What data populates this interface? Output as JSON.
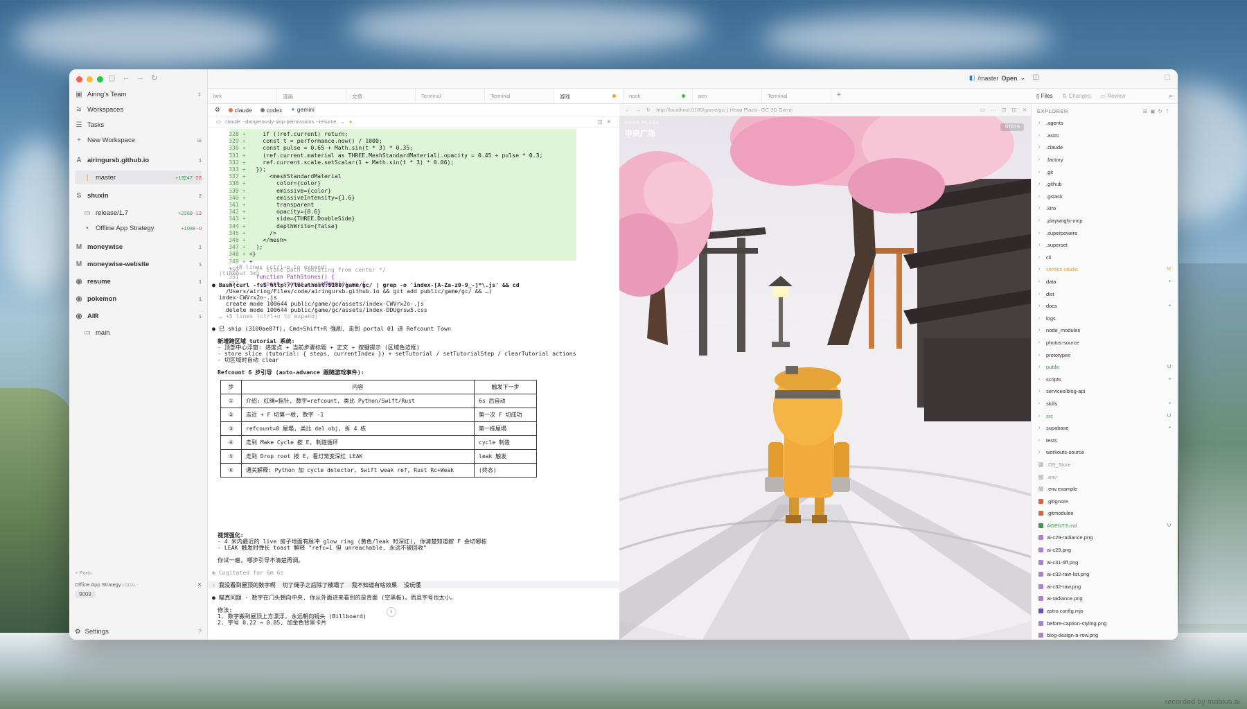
{
  "sidebar": {
    "team": "Airing's Team",
    "workspaces_label": "Workspaces",
    "tasks_label": "Tasks",
    "new_workspace_label": "New Workspace",
    "repos": [
      {
        "name": "airingursb.github.io",
        "count": "1",
        "sub": [
          {
            "name": "master",
            "added": "+13247",
            "removed": "-28"
          }
        ]
      },
      {
        "name": "shuxin",
        "count": "2",
        "sub": [
          {
            "name": "release/1.7",
            "added": "+2268",
            "removed": "-13"
          },
          {
            "name": "Offline App Strategy",
            "added": "+1088",
            "removed": "-0"
          }
        ]
      },
      {
        "name": "moneywise",
        "count": "1"
      },
      {
        "name": "moneywise-website",
        "count": "1"
      },
      {
        "name": "resume",
        "count": "1"
      },
      {
        "name": "pokemon",
        "count": "1"
      },
      {
        "name": "AIR",
        "count": "1",
        "sub": [
          {
            "name": "main"
          }
        ]
      }
    ],
    "ports_label": "Ports",
    "port_item": "Offline App Strategy",
    "port_local": "LOCAL",
    "port_number": "9009",
    "settings_label": "Settings"
  },
  "topbar": {
    "branch": "/master",
    "open_label": "Open"
  },
  "tabs": [
    {
      "label": "lark"
    },
    {
      "label": "漫画"
    },
    {
      "label": "文章"
    },
    {
      "label": "Terminal"
    },
    {
      "label": "Terminal"
    },
    {
      "label": "游戏",
      "active": true,
      "status_color": "#f0a030"
    },
    {
      "label": "nook",
      "status_color": "#3ab84a"
    },
    {
      "label": "pen"
    },
    {
      "label": "Terminal"
    }
  ],
  "agents": [
    {
      "label": "claude",
      "color": "#e07050"
    },
    {
      "label": "codex",
      "color": "#777777"
    },
    {
      "label": "gemini",
      "color": "#5a7ae0"
    }
  ],
  "cmdline": "claude --dangerously-skip-permissions --resume",
  "terminal": {
    "diff_lines": [
      {
        "n": "328",
        "code": "    if (!ref.current) return;"
      },
      {
        "n": "329",
        "code": "    const t = performance.now() / 1000;"
      },
      {
        "n": "330",
        "code": "    const pulse = 0.65 + Math.sin(t * 3) * 0.35;"
      },
      {
        "n": "331",
        "code": "    (ref.current.material as THREE.MeshStandardMaterial).opacity = 0.45 + pulse * 0.3;"
      },
      {
        "n": "332",
        "code": "    ref.current.scale.setScalar(1 + Math.sin(t * 3) * 0.06);"
      },
      {
        "n": "333",
        "code": "  });"
      },
      {
        "n": "337",
        "code": "      <meshStandardMaterial"
      },
      {
        "n": "338",
        "code": "        color={color}"
      },
      {
        "n": "339",
        "code": "        emissive={color}"
      },
      {
        "n": "340",
        "code": "        emissiveIntensity={1.6}"
      },
      {
        "n": "341",
        "code": "        transparent"
      },
      {
        "n": "342",
        "code": "        opacity={0.6}"
      },
      {
        "n": "343",
        "code": "        side={THREE.DoubleSide}"
      },
      {
        "n": "344",
        "code": "        depthWrite={false}"
      },
      {
        "n": "345",
        "code": "      />"
      },
      {
        "n": "346",
        "code": "    </mesh>"
      },
      {
        "n": "347",
        "code": "  );"
      },
      {
        "n": "348",
        "code": "+}"
      },
      {
        "n": "349",
        "code": "+"
      }
    ],
    "ctx_lines": [
      {
        "n": "350",
        "code": "  /* Stone path radiating from center */"
      },
      {
        "n": "351",
        "code": "  function PathStones() {"
      },
      {
        "n": "352",
        "code": "    const stones = useMemo(() => {"
      }
    ],
    "expand1": "… +8 lines (ctrl+o to expand)",
    "timeout": "(timeout 3m)",
    "bash1": "Bash(curl -fsS http://localhost:5180/game/gc/ | grep -o 'index-[A-Za-z0-9_-]*\\.js' && cd",
    "bash2": "  /Users/airing/Files/code/airingursb.github.io && git add public/game/gc/ && …)",
    "bash3": "index-CWVrx2o-.js",
    "bash4": "  create mode 100644 public/game/gc/assets/index-CWVrx2o-.js",
    "bash5": "  delete mode 100644 public/game/gc/assets/index-DDUgrsw5.css",
    "expand2": "… +5 lines (ctrl+o to expand)",
    "ship": "已 ship (3100ae07f), Cmd+Shift+R 强刷, 走到 portal 01 进 Refcount Town",
    "new_sys_title": "新增跨区域 tutorial 系统:",
    "new_sys_1": "- 顶部中心浮窗: 进度点 + 当前步骤标题 + 正文 + 按键提示 (区域色边框)",
    "new_sys_2": "- store slice (tutorial: { steps, currentIndex }) + setTutorial / setTutorialStep / clearTutorial actions",
    "new_sys_3": "- 切区域时自动 clear",
    "guide_title": "Refcount 6 步引导 (auto-advance 跟随游戏事件):",
    "table_head": [
      "步",
      "内容",
      "触发下一步"
    ],
    "table_rows": [
      [
        "①",
        "介绍: 红绳=指针, 数字=refcount, 类比 Python/Swift/Rust",
        "6s 后自动"
      ],
      [
        "②",
        "走近 + F 切第一根, 数字 -1",
        "第一次 F 切成功"
      ],
      [
        "③",
        "refcount=0 屋塌, 类比 del obj, 拆 4 栋",
        "第一栋屋塌"
      ],
      [
        "④",
        "走到 Make Cycle 按 E, 制造循环",
        "cycle 制造"
      ],
      [
        "⑤",
        "走到 Drop root 按 E, 看灯笼变深红 LEAK",
        "leak 触发"
      ],
      [
        "⑥",
        "通关解释: Python 加 cycle detector, Swift weak ref, Rust Rc+Weak",
        "(终态)"
      ]
    ],
    "visual_title": "视觉强化:",
    "visual_1": "- 4 米内最近的 live 房子地面有脉冲 glow ring (黄色/leak 时深红), 你清楚知道按 F 会切哪栋",
    "visual_2": "- LEAK 触发时弹长 toast 解释 \"refc=1 但 unreachable, 永远不被回收\"",
    "try_again": "你试一遍, 哪步引导不清楚再调。",
    "cogitated": "Cogitated for 6m 6s",
    "user_msg": "我没看到屋顶的数字啊  切了绳子之后除了楼塌了  我不知道有啥效果  没玩懂",
    "answer": "瞄真问题 - 数字在门头朝向中央, 你从外面进来看到的是背面 (空黑板)。而且字号也太小。",
    "fix_title": "修法:",
    "fix_1": "1. 数字搬到屋顶上方漂浮, 永远朝向镜头 (Billboard)",
    "fix_2": "2. 字号 0.22 → 0.85, 加金色背景卡片"
  },
  "browser": {
    "url": "http://localhost:5180/game/gc/ | Heap Plaza · GC 3D Game"
  },
  "game": {
    "region_en": "HEAP PLAZA",
    "region_cn": "中央广场",
    "stats": "STATS"
  },
  "files": {
    "tabs": [
      "Files",
      "Changes",
      "Review"
    ],
    "explorer_label": "EXPLORER",
    "entries": [
      {
        "name": ".agents",
        "type": "dir"
      },
      {
        "name": ".astro",
        "type": "dir"
      },
      {
        "name": ".claude",
        "type": "dir"
      },
      {
        "name": ".factory",
        "type": "dir"
      },
      {
        "name": ".git",
        "type": "dir"
      },
      {
        "name": ".github",
        "type": "dir"
      },
      {
        "name": ".gstack",
        "type": "dir"
      },
      {
        "name": ".kiro",
        "type": "dir"
      },
      {
        "name": ".playwright-mcp",
        "type": "dir"
      },
      {
        "name": ".superpowers",
        "type": "dir"
      },
      {
        "name": ".superset",
        "type": "dir"
      },
      {
        "name": "cli",
        "type": "dir"
      },
      {
        "name": "comics-studio",
        "type": "dir",
        "color": "#d9a040",
        "mark": "M"
      },
      {
        "name": "data",
        "type": "dir",
        "mark": "•"
      },
      {
        "name": "dist",
        "type": "dir"
      },
      {
        "name": "docs",
        "type": "dir",
        "mark": "•"
      },
      {
        "name": "logs",
        "type": "dir"
      },
      {
        "name": "node_modules",
        "type": "dir"
      },
      {
        "name": "photos-source",
        "type": "dir"
      },
      {
        "name": "prototypes",
        "type": "dir"
      },
      {
        "name": "public",
        "type": "dir",
        "color": "#3a9a4a",
        "mark": "U"
      },
      {
        "name": "scripts",
        "type": "dir",
        "mark": "•"
      },
      {
        "name": "services/blog-api",
        "type": "dir"
      },
      {
        "name": "skills",
        "type": "dir",
        "mark": "•"
      },
      {
        "name": "src",
        "type": "dir",
        "color": "#3a9a4a",
        "mark": "U"
      },
      {
        "name": "supabase",
        "type": "dir",
        "mark": "•"
      },
      {
        "name": "tests",
        "type": "dir"
      },
      {
        "name": "workouts-source",
        "type": "dir"
      },
      {
        "name": ".DS_Store",
        "type": "file",
        "color": "#999999"
      },
      {
        "name": ".env",
        "type": "file",
        "color": "#999999"
      },
      {
        "name": ".env.example",
        "type": "file"
      },
      {
        "name": ".gitignore",
        "type": "file",
        "icon": "#e06040"
      },
      {
        "name": ".gitmodules",
        "type": "file",
        "icon": "#e06040"
      },
      {
        "name": "AGENTS.md",
        "type": "file",
        "color": "#3a9a4a",
        "mark": "U",
        "icon": "#3a9a4a"
      },
      {
        "name": "ai-c29-radiance.png",
        "type": "file",
        "icon": "#b080d0"
      },
      {
        "name": "ai-c29.png",
        "type": "file",
        "icon": "#b080d0"
      },
      {
        "name": "ai-c31-tiff.png",
        "type": "file",
        "icon": "#b080d0"
      },
      {
        "name": "ai-c32-raw-list.png",
        "type": "file",
        "icon": "#b080d0"
      },
      {
        "name": "ai-c32-raw.png",
        "type": "file",
        "icon": "#b080d0"
      },
      {
        "name": "ai-radiance.png",
        "type": "file",
        "icon": "#b080d0"
      },
      {
        "name": "astro.config.mjs",
        "type": "file",
        "icon": "#6050c0"
      },
      {
        "name": "before-caption-styling.png",
        "type": "file",
        "icon": "#b080d0"
      },
      {
        "name": "blog-design-a-row.png",
        "type": "file",
        "icon": "#b080d0"
      }
    ]
  },
  "watermark": "recorded by mobius.ai"
}
